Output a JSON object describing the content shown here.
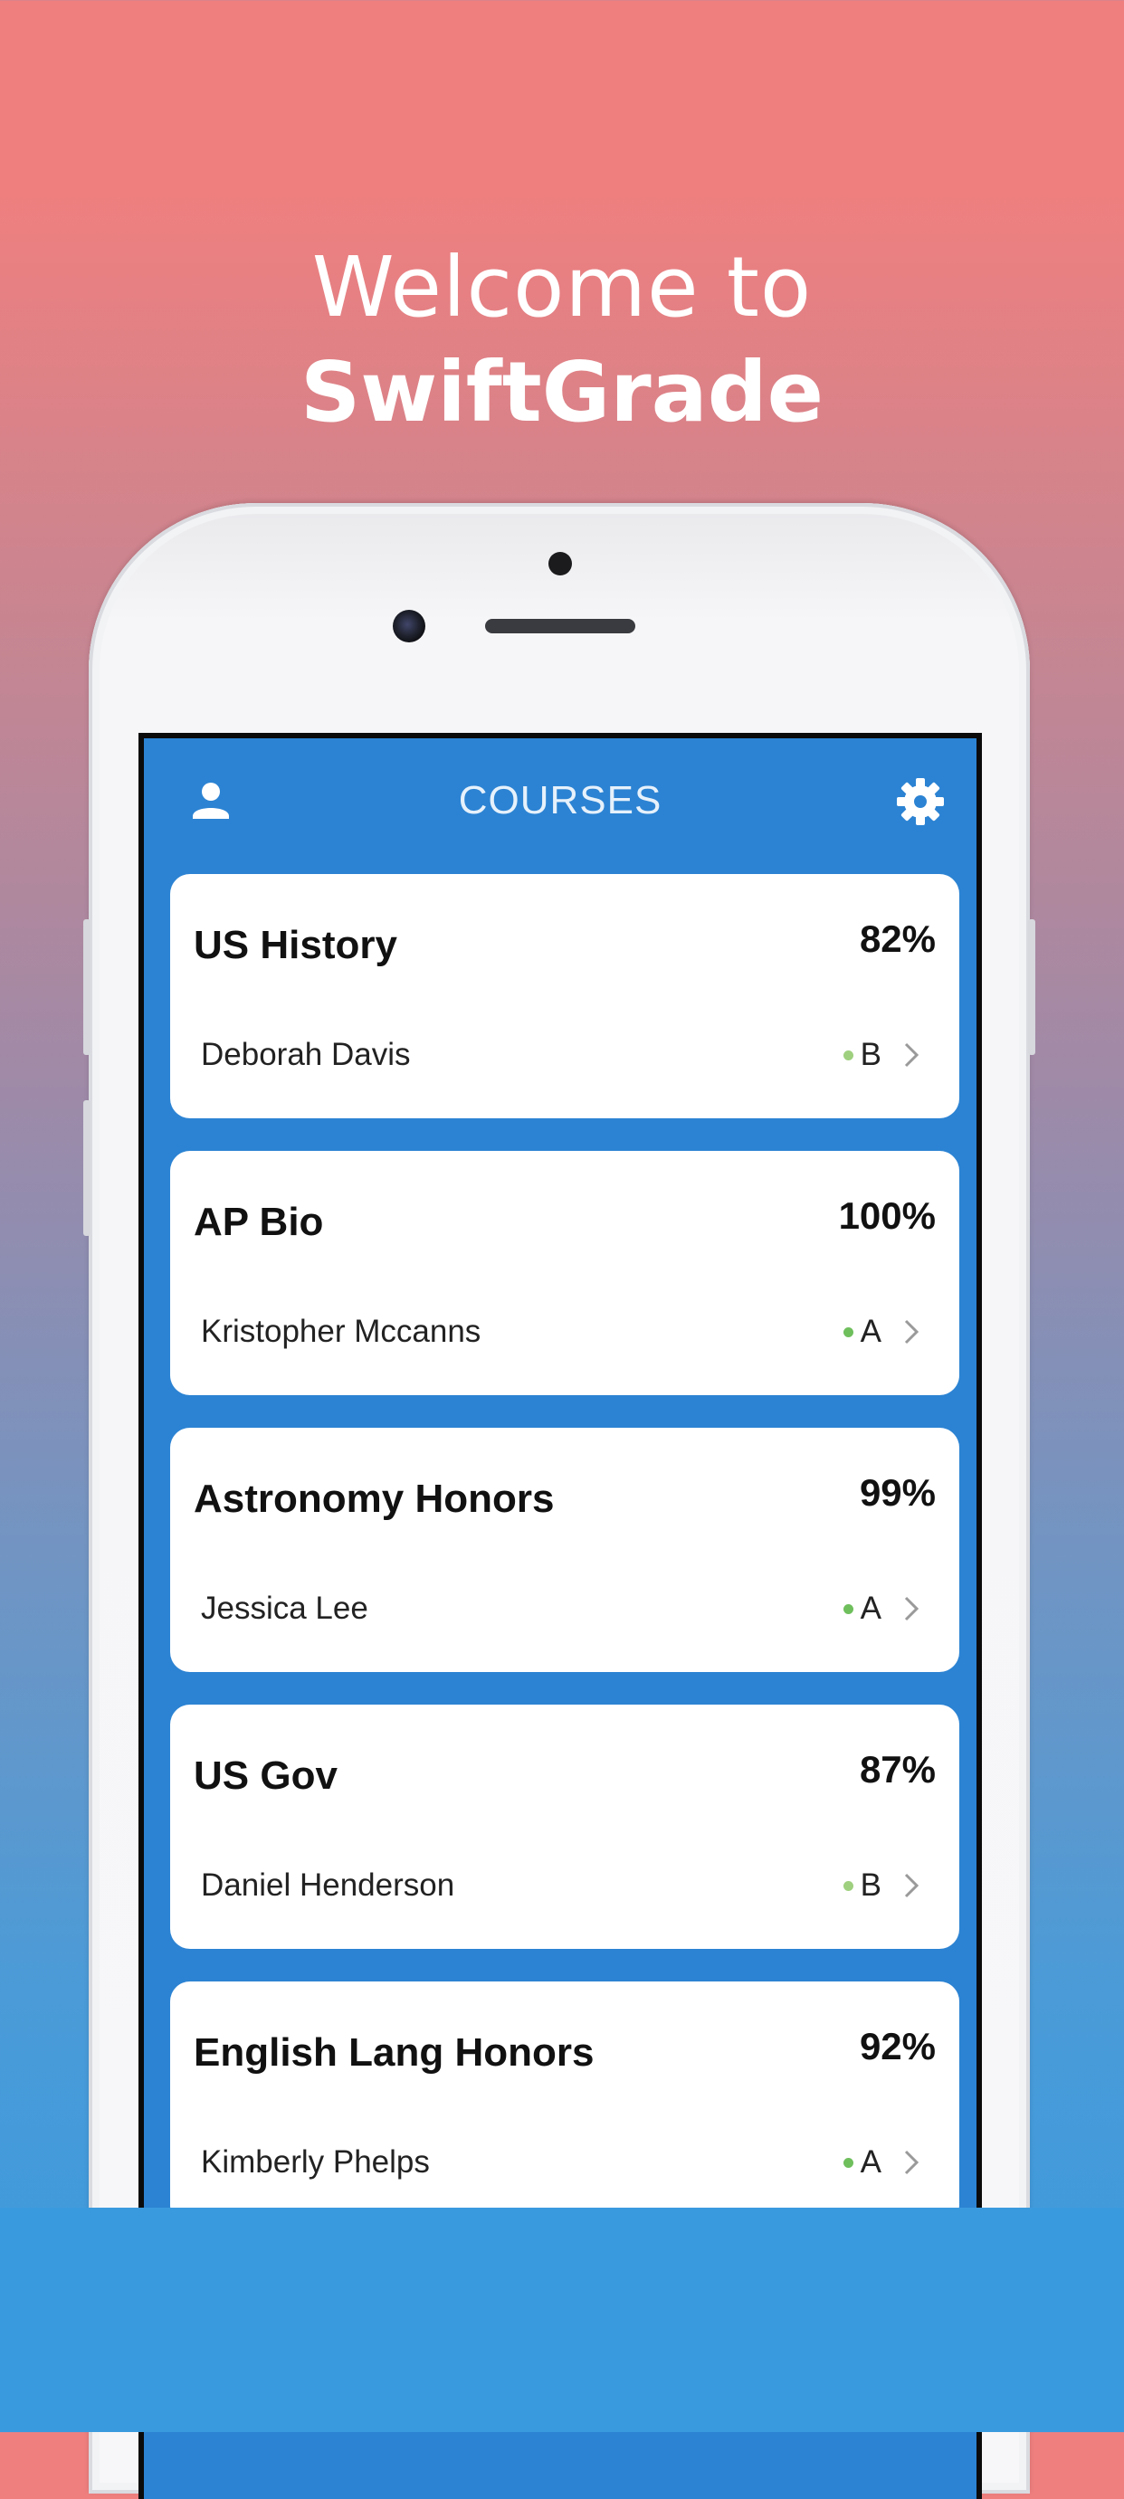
{
  "headline": {
    "line1": "Welcome to",
    "line2": "SwiftGrade"
  },
  "app": {
    "nav": {
      "title": "COURSES",
      "left_icon": "user-icon",
      "right_icon": "gear-icon"
    },
    "colors": {
      "primary": "#2c83d3",
      "card": "#ffffff",
      "dot_green": "#6fbf5d",
      "dot_lightgreen": "#9fd07f"
    },
    "courses": [
      {
        "name": "US History",
        "percent": "82%",
        "teacher": "Deborah Davis",
        "grade": "B"
      },
      {
        "name": "AP Bio",
        "percent": "100%",
        "teacher": "Kristopher Mccanns",
        "grade": "A"
      },
      {
        "name": "Astronomy Honors",
        "percent": "99%",
        "teacher": "Jessica Lee",
        "grade": "A"
      },
      {
        "name": "US Gov",
        "percent": "87%",
        "teacher": "Daniel Henderson",
        "grade": "B"
      },
      {
        "name": "English Lang Honors",
        "percent": "92%",
        "teacher": "Kimberly Phelps",
        "grade": "A"
      }
    ]
  }
}
